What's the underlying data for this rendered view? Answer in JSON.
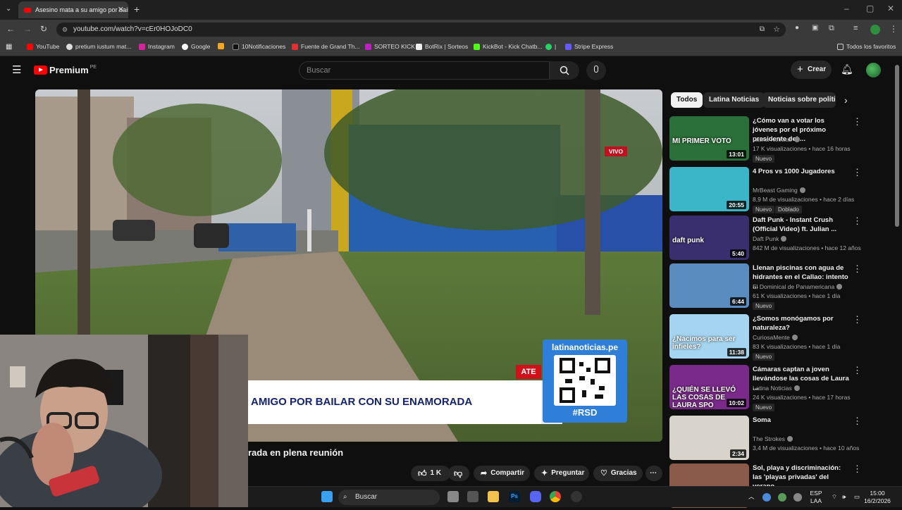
{
  "browser": {
    "tab_title": "Asesino mata a su amigo por bailar",
    "url": "youtube.com/watch?v=cEr0HOJoDC0",
    "bookmarks": [
      "YouTube",
      "pretium iustum mat...",
      "Instagram",
      "Google",
      "10Notificaciones",
      "Fuente de Grand Th...",
      "SORTEO KICK",
      "BotRix | Sorteos",
      "KickBot - Kick Chatb...",
      "|",
      "Stripe Express"
    ],
    "bookmarks_all": "Todos los favoritos"
  },
  "header": {
    "logo": "Premium",
    "region": "PE",
    "search_placeholder": "Buscar",
    "create_label": "Crear"
  },
  "video": {
    "live_badge": "VIVO",
    "banner_text": "AMIGO POR BAILAR CON SU ENAMORADA",
    "ate_label": "ATE",
    "qr_url": "latinanoticias.pe",
    "qr_tag": "#RSD",
    "title_fragment": "rada en plena reunión"
  },
  "actions": {
    "likes": "1 K",
    "share": "Compartir",
    "ask": "Preguntar",
    "thanks": "Gracias"
  },
  "chips": [
    "Todos",
    "Latina Noticias",
    "Noticias sobre política"
  ],
  "recommendations": [
    {
      "title": "¿Cómo van a votar los jóvenes por el próximo presidente del ...",
      "channel": "Latina Noticias",
      "stats": "17 K visualizaciones • hace 16 horas",
      "badge": "Nuevo",
      "duration": "13:01",
      "thumb_text": "MI PRIMER VOTO",
      "color": "#2b6f3a"
    },
    {
      "title": "4 Pros vs 1000 Jugadores",
      "channel": "MrBeast Gaming",
      "stats": "8,9 M de visualizaciones • hace 2 días",
      "badge": "Nuevo",
      "extra": "Doblado",
      "duration": "20:55",
      "thumb_text": "",
      "color": "#3ab6c8"
    },
    {
      "title": "Daft Punk - Instant Crush (Official Video) ft. Julian ...",
      "channel": "Daft Punk",
      "stats": "842 M de visualizaciones • hace 12 años",
      "duration": "5:40",
      "thumb_text": "daft punk",
      "color": "#3a2f6e"
    },
    {
      "title": "Llenan piscinas con agua de hidrantes en el Callao: intento ...",
      "channel": "El Dominical de Panamericana",
      "stats": "61 K visualizaciones • hace 1 día",
      "badge": "Nuevo",
      "duration": "6:44",
      "thumb_text": "",
      "color": "#5a8cc0"
    },
    {
      "title": "¿Somos monógamos por naturaleza?",
      "channel": "CuriosaMente",
      "stats": "83 K visualizaciones • hace 1 día",
      "badge": "Nuevo",
      "duration": "11:38",
      "thumb_text": "¿Nacimos para ser infieles?",
      "color": "#a4d4f0"
    },
    {
      "title": "Cámaras captan a joven llevándose las cosas de Laura ...",
      "channel": "Latina Noticias",
      "stats": "24 K visualizaciones • hace 17 horas",
      "badge": "Nuevo",
      "duration": "10:02",
      "thumb_text": "¿QUIÉN SE LLEVÓ LAS COSAS DE LAURA SPO",
      "color": "#7a2a8a"
    },
    {
      "title": "Soma",
      "channel": "The Strokes",
      "stats": "3,4 M de visualizaciones • hace 10 años",
      "duration": "2:34",
      "thumb_text": "",
      "color": "#d8d4cc"
    },
    {
      "title": "Sol, playa y discriminación: las 'playas privadas' del verano ...",
      "channel": "",
      "stats": "",
      "duration": "",
      "thumb_text": "",
      "color": "#8a5a4a"
    }
  ],
  "taskbar": {
    "search": "Buscar",
    "lang": "ESP",
    "region": "LAA",
    "time": "15:00",
    "date": "16/2/2026"
  }
}
